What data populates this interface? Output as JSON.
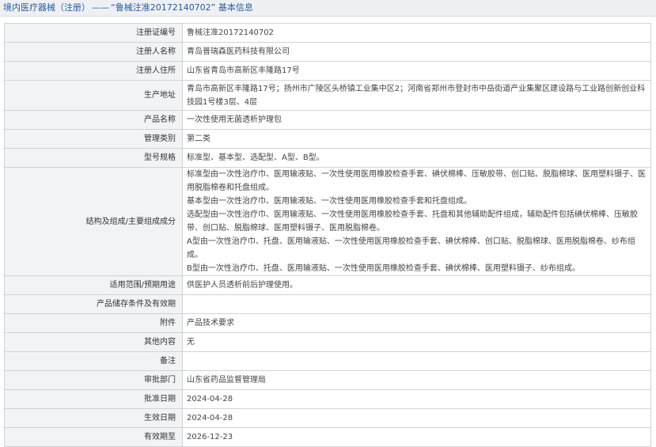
{
  "header": {
    "category": "境内医疗器械（注册）",
    "separator": "——",
    "record_title": "“鲁械注准20172140702”",
    "suffix": "基本信息"
  },
  "rows": [
    {
      "label": "注册证编号",
      "value": "鲁械注准20172140702"
    },
    {
      "label": "注册人名称",
      "value": "青岛普瑞森医药科技有限公司"
    },
    {
      "label": "注册人住所",
      "value": "山东省青岛市高新区丰隆路17号"
    },
    {
      "label": "生产地址",
      "value": "青岛市高新区丰隆路17号；扬州市广陵区头桥镇工业集中区2；河南省郑州市登封市中岳街道产业集聚区建设路与工业路创新创业科技园1号楼3层、4层"
    },
    {
      "label": "产品名称",
      "value": "一次性使用无菌透析护理包"
    },
    {
      "label": "管理类别",
      "value": "第二类"
    },
    {
      "label": "型号规格",
      "value": "标准型、基本型、选配型、A型、B型。"
    },
    {
      "label": "结构及组成/主要组成成分",
      "lines": [
        "标准型由一次性治疗巾、医用输液贴、一次性使用医用橡胶检查手套、碘伏棉棒、压敏胶带、创口贴、脱脂棉球、医用塑料镊子、医用脱脂棉卷和托盘组成。",
        "基本型由一次性治疗巾、医用输液贴、一次性使用医用橡胶检查手套和托盘组成。",
        "选配型由一次性治疗巾、医用输液贴、一次性使用医用橡胶检查手套、托盘和其他辅助配件组成，辅助配件包括碘伏棉棒、压敏胶带、创口贴、脱脂棉球、医用塑料镊子、医用脱脂棉卷。",
        "A型由一次性治疗巾、托盘、医用输液贴、一次性使用医用橡胶检查手套、碘伏棉棒、创口贴、脱脂棉球、医用脱脂棉卷、纱布组成。",
        "B型由一次性治疗巾、托盘、医用输液贴、一次性使用医用橡胶检查手套、碘伏棉棒、医用塑料镊子、纱布组成。"
      ]
    },
    {
      "label": "适用范围/预期用途",
      "value": "供医护人员透析前后护理使用。"
    },
    {
      "label": "产品储存条件及有效期",
      "value": ""
    },
    {
      "label": "附件",
      "value": "产品技术要求"
    },
    {
      "label": "其他内容",
      "value": "无"
    },
    {
      "label": "备注",
      "value": ""
    },
    {
      "label": "审批部门",
      "value": "山东省药品监督管理局"
    },
    {
      "label": "批准日期",
      "value": "2024-04-28"
    },
    {
      "label": "生效日期",
      "value": "2024-04-28"
    },
    {
      "label": "有效期至",
      "value": "2026-12-23"
    }
  ]
}
